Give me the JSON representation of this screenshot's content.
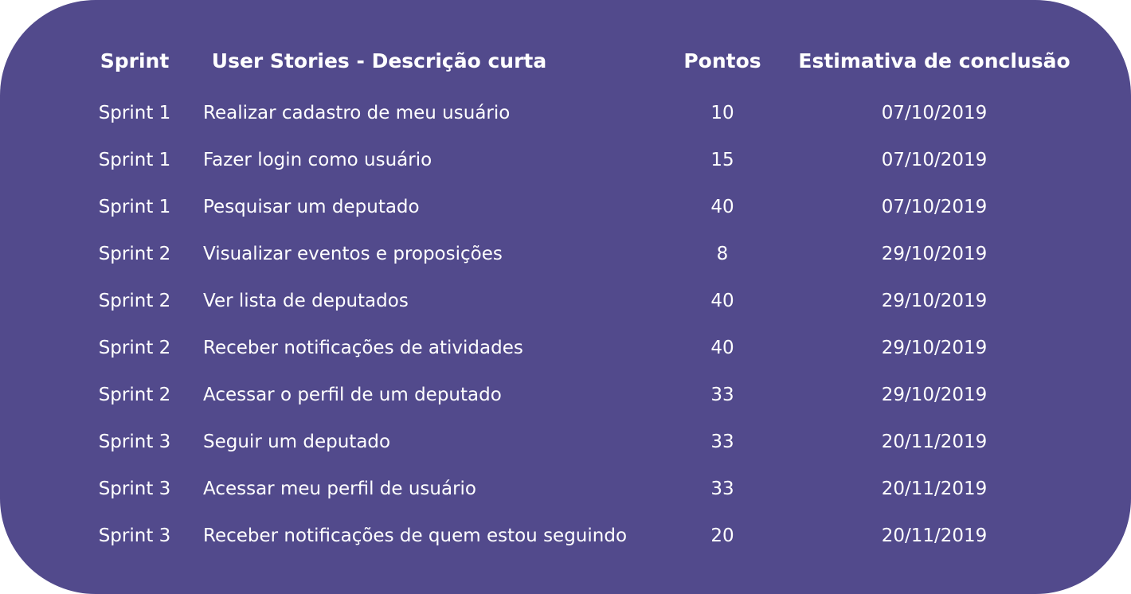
{
  "table": {
    "headers": {
      "sprint": "Sprint",
      "story": "User Stories - Descrição curta",
      "points": "Pontos",
      "estimate": "Estimativa de conclusão"
    },
    "rows": [
      {
        "sprint": "Sprint 1",
        "story": "Realizar cadastro de meu usuário",
        "points": "10",
        "estimate": "07/10/2019"
      },
      {
        "sprint": "Sprint 1",
        "story": "Fazer login como usuário",
        "points": "15",
        "estimate": "07/10/2019"
      },
      {
        "sprint": "Sprint 1",
        "story": "Pesquisar um deputado",
        "points": "40",
        "estimate": "07/10/2019"
      },
      {
        "sprint": "Sprint 2",
        "story": "Visualizar eventos e proposições",
        "points": "8",
        "estimate": "29/10/2019"
      },
      {
        "sprint": "Sprint 2",
        "story": "Ver lista de deputados",
        "points": "40",
        "estimate": "29/10/2019"
      },
      {
        "sprint": "Sprint 2",
        "story": "Receber notificações de atividades",
        "points": "40",
        "estimate": "29/10/2019"
      },
      {
        "sprint": "Sprint 2",
        "story": "Acessar o perfil de um deputado",
        "points": "33",
        "estimate": "29/10/2019"
      },
      {
        "sprint": "Sprint 3",
        "story": "Seguir um deputado",
        "points": "33",
        "estimate": "20/11/2019"
      },
      {
        "sprint": "Sprint 3",
        "story": "Acessar meu perfil de usuário",
        "points": "33",
        "estimate": "20/11/2019"
      },
      {
        "sprint": "Sprint 3",
        "story": "Receber notificações de quem estou seguindo",
        "points": "20",
        "estimate": "20/11/2019"
      }
    ]
  },
  "colors": {
    "card_background": "#524a8c",
    "text": "#ffffff"
  }
}
